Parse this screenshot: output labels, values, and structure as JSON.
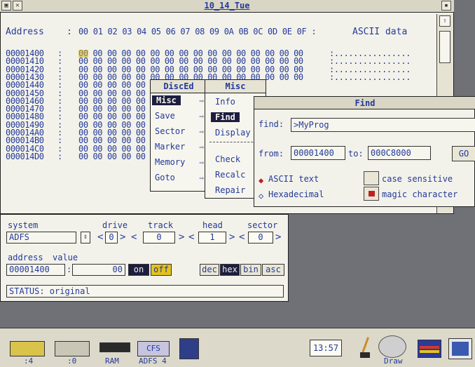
{
  "window": {
    "title": "10_14_Tue"
  },
  "header": {
    "address_label": "Address",
    "sep": ":",
    "bytes": "00 01 02 03 04 05 06 07 08 09 0A 0B 0C 0D 0E 0F :",
    "ascii_label": "ASCII data"
  },
  "rows": [
    {
      "addr": "00001400",
      "bytes": "00 00 00 00 00 00 00 00 00 00 00 00 00 00 00 00",
      "ascii": ":................"
    },
    {
      "addr": "00001410",
      "bytes": "00 00 00 00 00 00 00 00 00 00 00 00 00 00 00 00",
      "ascii": ":................"
    },
    {
      "addr": "00001420",
      "bytes": "00 00 00 00 00 00 00 00 00 00 00 00 00 00 00 00",
      "ascii": ":................"
    },
    {
      "addr": "00001430",
      "bytes": "00 00 00 00 00 00 00 00 00 00 00 00 00 00 00 00",
      "ascii": ":................"
    },
    {
      "addr": "00001440",
      "bytes": "00 00 00 00 00",
      "ascii": ""
    },
    {
      "addr": "00001450",
      "bytes": "00 00 00 00 00",
      "ascii": ""
    },
    {
      "addr": "00001460",
      "bytes": "00 00 00 00 00",
      "ascii": ""
    },
    {
      "addr": "00001470",
      "bytes": "00 00 00 00 00",
      "ascii": ""
    },
    {
      "addr": "00001480",
      "bytes": "00 00 00 00 00",
      "ascii": ""
    },
    {
      "addr": "00001490",
      "bytes": "00 00 00 00 00",
      "ascii": ""
    },
    {
      "addr": "000014A0",
      "bytes": "00 00 00 00 00",
      "ascii": ""
    },
    {
      "addr": "000014B0",
      "bytes": "00 00 00 00 00",
      "ascii": ""
    },
    {
      "addr": "000014C0",
      "bytes": "00 00 00 00 00 00 00 00 00 00",
      "ascii": ""
    },
    {
      "addr": "000014D0",
      "bytes": "00 00 00 00 00 00 00 00 00 00 00 00 00 00 00 00",
      "ascii": ""
    }
  ],
  "panel": {
    "system_label": "system",
    "system_value": "ADFS",
    "drive_label": "drive",
    "drive_value": "0",
    "track_label": "track",
    "track_value": "0",
    "head_label": "head",
    "head_value": "1",
    "sector_label": "sector",
    "sector_value": "0",
    "address_label": "address",
    "address_value": "00001400",
    "value_label": "value",
    "value_value": "00",
    "on_label": "on",
    "off_label": "off",
    "dec_label": "dec",
    "hex_label": "hex",
    "bin_label": "bin",
    "asc_label": "asc",
    "status": "STATUS: original"
  },
  "menu_disced": {
    "title": "DiscEd",
    "items": [
      "Misc",
      "Save",
      "Sector",
      "Marker",
      "Memory",
      "Goto"
    ]
  },
  "menu_misc": {
    "title": "Misc",
    "items": [
      "Info",
      "Find",
      "Display",
      "Check",
      "Recalc",
      "Repair"
    ]
  },
  "find": {
    "title": "Find",
    "find_label": "find:",
    "find_value": ">MyProg",
    "from_label": "from:",
    "from_value": "00001400",
    "to_label": "to:",
    "to_value": "000C8000",
    "go_label": "GO",
    "ascii_label": "ASCII text",
    "hex_label": "Hexadecimal",
    "case_label": "case sensitive",
    "magic_label": "magic character"
  },
  "taskbar": {
    "labels": [
      ":4",
      ":0",
      "RAM",
      "ADFS 4"
    ],
    "cfs_label": "CFS",
    "clock": "13:57",
    "draw_label": "Draw"
  },
  "colors": {
    "text": "#233a9a",
    "desktop": "#6f7177",
    "window_bg": "#f3f2ea",
    "cursor": "#d8b81a",
    "selected": "#1d1d40",
    "magic_checkbox": "#c0201e"
  }
}
